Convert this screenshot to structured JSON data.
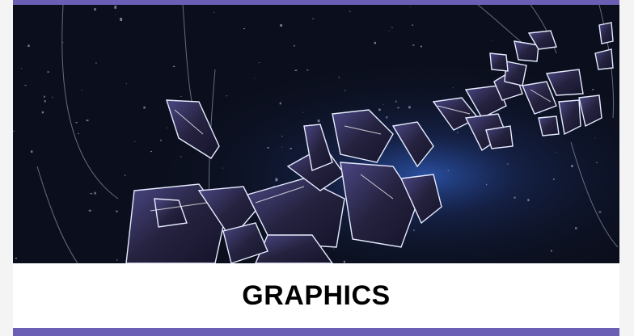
{
  "colors": {
    "accent": "#6b5fb5",
    "hero_background": "#0b0f1d",
    "shard_fill": "#2e2a55",
    "shard_highlight": "#dfe6ff",
    "glow": "#3a62c8"
  },
  "hero": {
    "image_name": "shattered-glass-image"
  },
  "card": {
    "title": "GRAPHICS"
  }
}
